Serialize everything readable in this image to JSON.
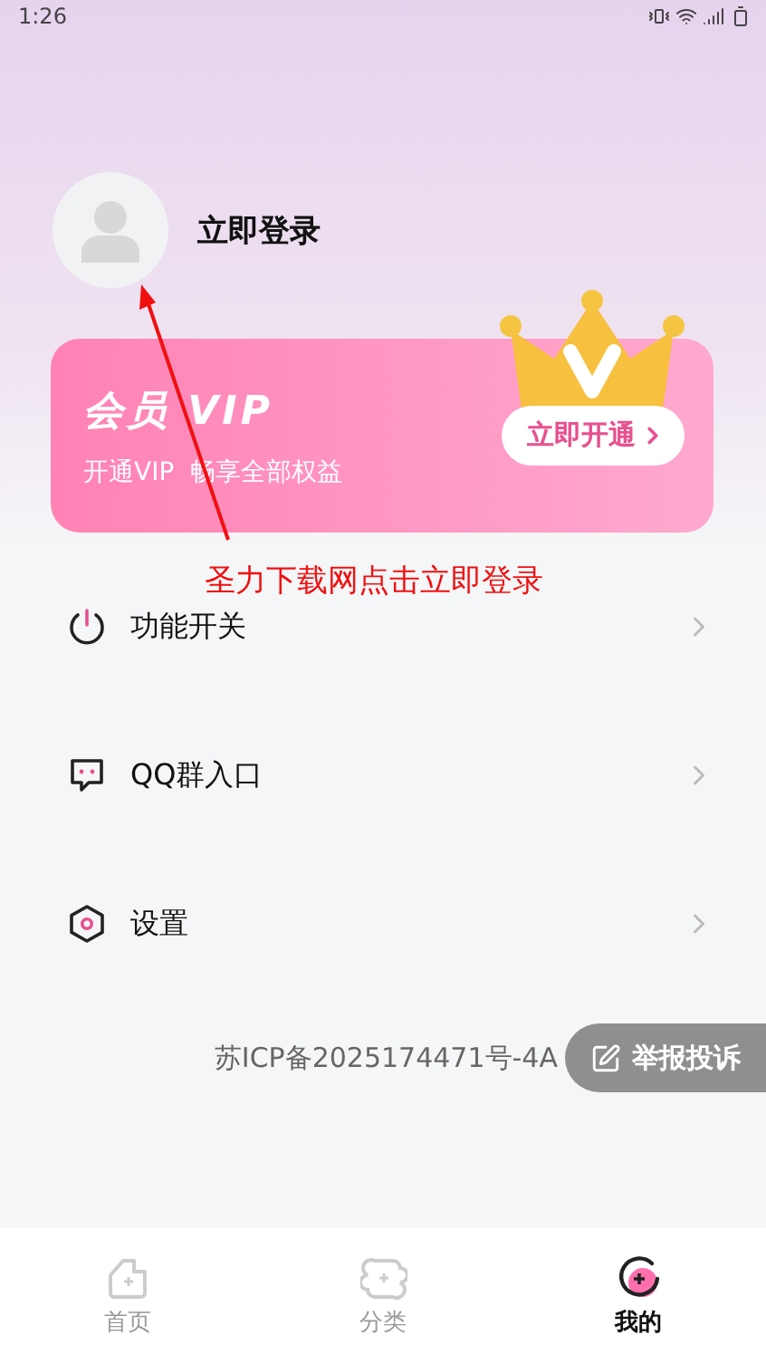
{
  "status_bar": {
    "time": "1:26"
  },
  "header": {
    "login": "立即登录"
  },
  "vip_card": {
    "title": "会员 VIP",
    "subtitle": "开通VIP  畅享全部权益",
    "button": "立即开通"
  },
  "annotation": {
    "text": "圣力下载网点击立即登录"
  },
  "menu": [
    {
      "kind": "power",
      "label": "功能开关"
    },
    {
      "kind": "chat",
      "label": "QQ群入口"
    },
    {
      "kind": "settings",
      "label": "设置"
    }
  ],
  "footer": {
    "icp": "苏ICP备2025174471号-4A",
    "report_button": "举报投诉"
  },
  "tabs": [
    {
      "kind": "home",
      "label": "首页",
      "selected": false
    },
    {
      "kind": "category",
      "label": "分类",
      "selected": false
    },
    {
      "kind": "mine",
      "label": "我的",
      "selected": true
    }
  ]
}
